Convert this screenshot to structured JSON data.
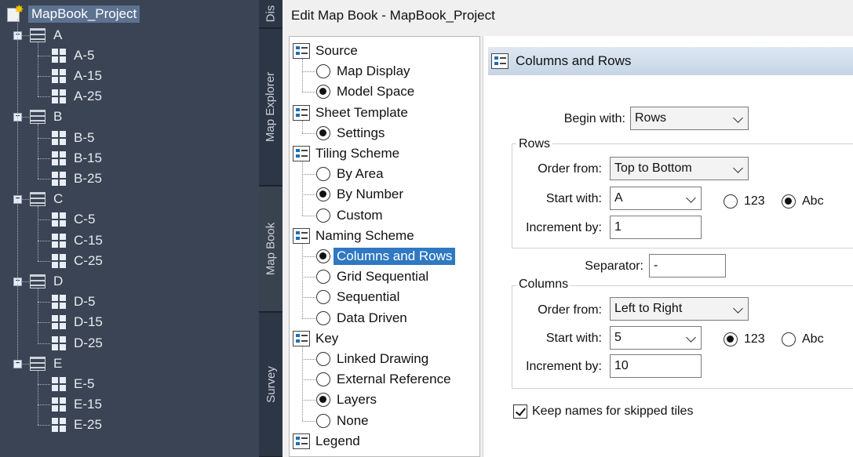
{
  "tree": {
    "root": "MapBook_Project",
    "groups": [
      {
        "label": "A",
        "items": [
          "A-5",
          "A-15",
          "A-25"
        ]
      },
      {
        "label": "B",
        "items": [
          "B-5",
          "B-15",
          "B-25"
        ]
      },
      {
        "label": "C",
        "items": [
          "C-5",
          "C-15",
          "C-25"
        ]
      },
      {
        "label": "D",
        "items": [
          "D-5",
          "D-15",
          "D-25"
        ]
      },
      {
        "label": "E",
        "items": [
          "E-5",
          "E-15",
          "E-25"
        ]
      }
    ]
  },
  "tabs": [
    "Dis",
    "Map Explorer",
    "Map Book",
    "Survey"
  ],
  "dialog": {
    "title": "Edit Map Book - MapBook_Project",
    "nav": [
      {
        "label": "Source",
        "type": "section"
      },
      {
        "label": "Map Display",
        "type": "radio",
        "checked": false
      },
      {
        "label": "Model Space",
        "type": "radio",
        "checked": true
      },
      {
        "label": "Sheet Template",
        "type": "section"
      },
      {
        "label": "Settings",
        "type": "radio",
        "checked": true
      },
      {
        "label": "Tiling Scheme",
        "type": "section"
      },
      {
        "label": "By Area",
        "type": "radio",
        "checked": false
      },
      {
        "label": "By Number",
        "type": "radio",
        "checked": true
      },
      {
        "label": "Custom",
        "type": "radio",
        "checked": false
      },
      {
        "label": "Naming Scheme",
        "type": "section"
      },
      {
        "label": "Columns and Rows",
        "type": "radio",
        "checked": true,
        "selected": true
      },
      {
        "label": "Grid Sequential",
        "type": "radio",
        "checked": false
      },
      {
        "label": "Sequential",
        "type": "radio",
        "checked": false
      },
      {
        "label": "Data Driven",
        "type": "radio",
        "checked": false
      },
      {
        "label": "Key",
        "type": "section"
      },
      {
        "label": "Linked Drawing",
        "type": "radio",
        "checked": false
      },
      {
        "label": "External Reference",
        "type": "radio",
        "checked": false
      },
      {
        "label": "Layers",
        "type": "radio",
        "checked": true
      },
      {
        "label": "None",
        "type": "radio",
        "checked": false
      },
      {
        "label": "Legend",
        "type": "section"
      }
    ],
    "panel": {
      "header": "Columns and Rows",
      "begin_with_label": "Begin with:",
      "begin_with_value": "Rows",
      "rows": {
        "title": "Rows",
        "order_label": "Order from:",
        "order_value": "Top to Bottom",
        "start_label": "Start with:",
        "start_value": "A",
        "opt_numeric": "123",
        "opt_alpha": "Abc",
        "numeric_checked": false,
        "alpha_checked": true,
        "increment_label": "Increment by:",
        "increment_value": "1"
      },
      "separator_label": "Separator:",
      "separator_value": "-",
      "columns": {
        "title": "Columns",
        "order_label": "Order from:",
        "order_value": "Left to Right",
        "start_label": "Start with:",
        "start_value": "5",
        "opt_numeric": "123",
        "opt_alpha": "Abc",
        "numeric_checked": true,
        "alpha_checked": false,
        "increment_label": "Increment by:",
        "increment_value": "10"
      },
      "keep_names_label": "Keep names for skipped tiles",
      "keep_names_checked": true
    }
  }
}
